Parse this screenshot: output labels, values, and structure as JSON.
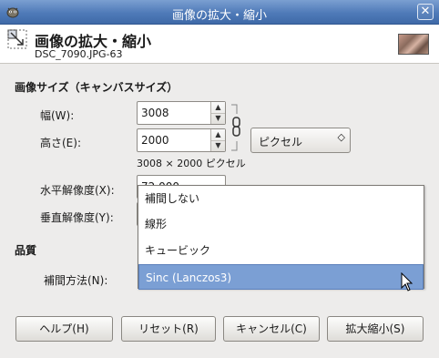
{
  "window": {
    "title": "画像の拡大・縮小",
    "close_icon": "close-icon"
  },
  "header": {
    "title": "画像の拡大・縮小",
    "subtitle": "DSC_7090.JPG-63"
  },
  "image_size": {
    "section_label": "画像サイズ（キャンバスサイズ）",
    "width_label": "幅(W):",
    "width_value": "3008",
    "height_label": "高さ(E):",
    "height_value": "2000",
    "unit_value": "ピクセル",
    "size_info": "3008 × 2000 ピクセル"
  },
  "resolution": {
    "x_label": "水平解像度(X):",
    "x_value": "72.000",
    "y_label": "垂直解像度(Y):"
  },
  "quality": {
    "section_label": "品質",
    "interpolation_label": "補間方法(N):"
  },
  "dropdown": {
    "options": [
      "補間しない",
      "線形",
      "キュービック",
      "Sinc (Lanczos3)"
    ],
    "selected_index": 3
  },
  "buttons": {
    "help": "ヘルプ(H)",
    "reset": "リセット(R)",
    "cancel": "キャンセル(C)",
    "scale": "拡大縮小(S)"
  },
  "colors": {
    "titlebar": "#4f7ab8",
    "selection": "#7b9fd4"
  }
}
